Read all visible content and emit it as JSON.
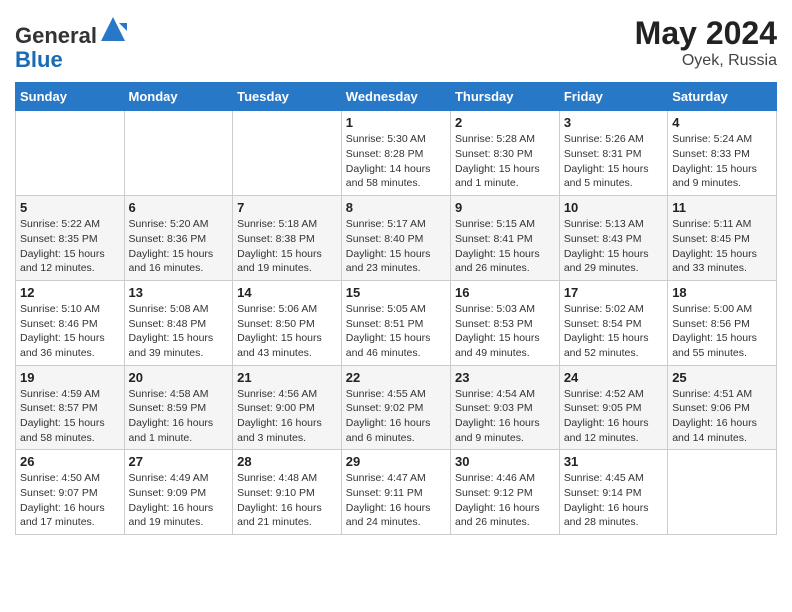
{
  "header": {
    "logo_general": "General",
    "logo_blue": "Blue",
    "month_year": "May 2024",
    "location": "Oyek, Russia"
  },
  "days_of_week": [
    "Sunday",
    "Monday",
    "Tuesday",
    "Wednesday",
    "Thursday",
    "Friday",
    "Saturday"
  ],
  "weeks": [
    [
      {
        "day": "",
        "info": ""
      },
      {
        "day": "",
        "info": ""
      },
      {
        "day": "",
        "info": ""
      },
      {
        "day": "1",
        "info": "Sunrise: 5:30 AM\nSunset: 8:28 PM\nDaylight: 14 hours\nand 58 minutes."
      },
      {
        "day": "2",
        "info": "Sunrise: 5:28 AM\nSunset: 8:30 PM\nDaylight: 15 hours\nand 1 minute."
      },
      {
        "day": "3",
        "info": "Sunrise: 5:26 AM\nSunset: 8:31 PM\nDaylight: 15 hours\nand 5 minutes."
      },
      {
        "day": "4",
        "info": "Sunrise: 5:24 AM\nSunset: 8:33 PM\nDaylight: 15 hours\nand 9 minutes."
      }
    ],
    [
      {
        "day": "5",
        "info": "Sunrise: 5:22 AM\nSunset: 8:35 PM\nDaylight: 15 hours\nand 12 minutes."
      },
      {
        "day": "6",
        "info": "Sunrise: 5:20 AM\nSunset: 8:36 PM\nDaylight: 15 hours\nand 16 minutes."
      },
      {
        "day": "7",
        "info": "Sunrise: 5:18 AM\nSunset: 8:38 PM\nDaylight: 15 hours\nand 19 minutes."
      },
      {
        "day": "8",
        "info": "Sunrise: 5:17 AM\nSunset: 8:40 PM\nDaylight: 15 hours\nand 23 minutes."
      },
      {
        "day": "9",
        "info": "Sunrise: 5:15 AM\nSunset: 8:41 PM\nDaylight: 15 hours\nand 26 minutes."
      },
      {
        "day": "10",
        "info": "Sunrise: 5:13 AM\nSunset: 8:43 PM\nDaylight: 15 hours\nand 29 minutes."
      },
      {
        "day": "11",
        "info": "Sunrise: 5:11 AM\nSunset: 8:45 PM\nDaylight: 15 hours\nand 33 minutes."
      }
    ],
    [
      {
        "day": "12",
        "info": "Sunrise: 5:10 AM\nSunset: 8:46 PM\nDaylight: 15 hours\nand 36 minutes."
      },
      {
        "day": "13",
        "info": "Sunrise: 5:08 AM\nSunset: 8:48 PM\nDaylight: 15 hours\nand 39 minutes."
      },
      {
        "day": "14",
        "info": "Sunrise: 5:06 AM\nSunset: 8:50 PM\nDaylight: 15 hours\nand 43 minutes."
      },
      {
        "day": "15",
        "info": "Sunrise: 5:05 AM\nSunset: 8:51 PM\nDaylight: 15 hours\nand 46 minutes."
      },
      {
        "day": "16",
        "info": "Sunrise: 5:03 AM\nSunset: 8:53 PM\nDaylight: 15 hours\nand 49 minutes."
      },
      {
        "day": "17",
        "info": "Sunrise: 5:02 AM\nSunset: 8:54 PM\nDaylight: 15 hours\nand 52 minutes."
      },
      {
        "day": "18",
        "info": "Sunrise: 5:00 AM\nSunset: 8:56 PM\nDaylight: 15 hours\nand 55 minutes."
      }
    ],
    [
      {
        "day": "19",
        "info": "Sunrise: 4:59 AM\nSunset: 8:57 PM\nDaylight: 15 hours\nand 58 minutes."
      },
      {
        "day": "20",
        "info": "Sunrise: 4:58 AM\nSunset: 8:59 PM\nDaylight: 16 hours\nand 1 minute."
      },
      {
        "day": "21",
        "info": "Sunrise: 4:56 AM\nSunset: 9:00 PM\nDaylight: 16 hours\nand 3 minutes."
      },
      {
        "day": "22",
        "info": "Sunrise: 4:55 AM\nSunset: 9:02 PM\nDaylight: 16 hours\nand 6 minutes."
      },
      {
        "day": "23",
        "info": "Sunrise: 4:54 AM\nSunset: 9:03 PM\nDaylight: 16 hours\nand 9 minutes."
      },
      {
        "day": "24",
        "info": "Sunrise: 4:52 AM\nSunset: 9:05 PM\nDaylight: 16 hours\nand 12 minutes."
      },
      {
        "day": "25",
        "info": "Sunrise: 4:51 AM\nSunset: 9:06 PM\nDaylight: 16 hours\nand 14 minutes."
      }
    ],
    [
      {
        "day": "26",
        "info": "Sunrise: 4:50 AM\nSunset: 9:07 PM\nDaylight: 16 hours\nand 17 minutes."
      },
      {
        "day": "27",
        "info": "Sunrise: 4:49 AM\nSunset: 9:09 PM\nDaylight: 16 hours\nand 19 minutes."
      },
      {
        "day": "28",
        "info": "Sunrise: 4:48 AM\nSunset: 9:10 PM\nDaylight: 16 hours\nand 21 minutes."
      },
      {
        "day": "29",
        "info": "Sunrise: 4:47 AM\nSunset: 9:11 PM\nDaylight: 16 hours\nand 24 minutes."
      },
      {
        "day": "30",
        "info": "Sunrise: 4:46 AM\nSunset: 9:12 PM\nDaylight: 16 hours\nand 26 minutes."
      },
      {
        "day": "31",
        "info": "Sunrise: 4:45 AM\nSunset: 9:14 PM\nDaylight: 16 hours\nand 28 minutes."
      },
      {
        "day": "",
        "info": ""
      }
    ]
  ]
}
